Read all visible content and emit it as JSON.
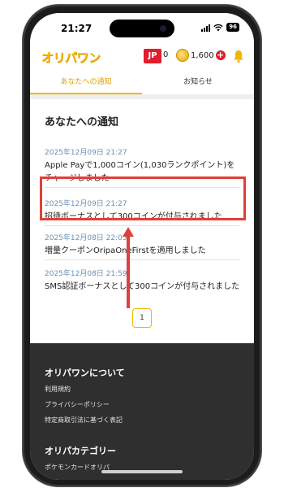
{
  "status_bar": {
    "time": "21:27",
    "battery": "96"
  },
  "header": {
    "logo_text": "オリパワン",
    "region_badge": "JP",
    "region_count": "0",
    "coin_count": "1,600",
    "coin_plus": "+"
  },
  "tabs": [
    {
      "label": "あなたへの通知",
      "active": true
    },
    {
      "label": "お知らせ",
      "active": false
    }
  ],
  "main": {
    "title": "あなたへの通知",
    "notifications": [
      {
        "date": "2025年12月09日 21:27",
        "text": "Apple Payで1,000コイン(1,030ランクポイント)をチャージしました"
      },
      {
        "date": "2025年12月09日 21:27",
        "text": "招待ボーナスとして300コインが付与されました"
      },
      {
        "date": "2025年12月08日 22:05",
        "text": "増量クーポンOripaOneFirstを適用しました"
      },
      {
        "date": "2025年12月08日 21:59",
        "text": "SMS認証ボーナスとして300コインが付与されました"
      }
    ],
    "pagination": {
      "current_page": "1"
    }
  },
  "footer": {
    "about_heading": "オリパワンについて",
    "links": [
      "利用規約",
      "プライバシーポリシー",
      "特定商取引法に基づく表記"
    ],
    "category_heading": "オリパカテゴリー",
    "category_links": [
      "ポケモンカードオリパ"
    ]
  },
  "colors": {
    "brand_yellow": "#f4b400",
    "badge_red": "#e21d2d",
    "highlight_red": "#e0403a",
    "date_blue": "#6b8fb5",
    "footer_bg": "#2f2f2f"
  }
}
